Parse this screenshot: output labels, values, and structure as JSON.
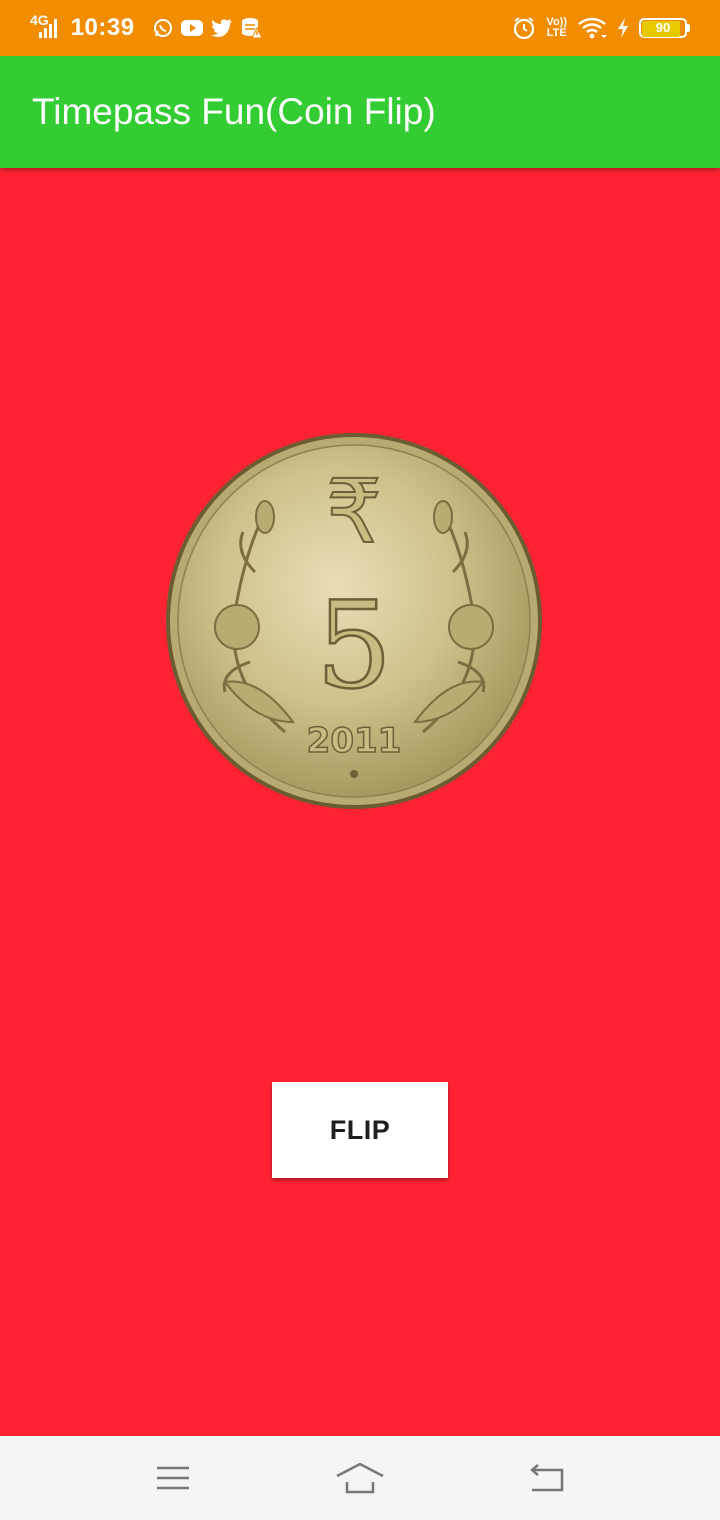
{
  "status_bar": {
    "network_type": "4G",
    "time": "10:39",
    "notifications": [
      "whatsapp-icon",
      "youtube-icon",
      "twitter-icon",
      "storage-alert-icon"
    ],
    "volte_top": "Vo))",
    "volte_bottom": "LTE",
    "battery_level": "90",
    "battery_fraction": 0.9
  },
  "app_bar": {
    "title": "Timepass Fun(Coin Flip)"
  },
  "coin": {
    "value": "5",
    "year": "2011",
    "currency_symbol": "₹"
  },
  "flip_button": {
    "label": "FLIP"
  },
  "nav_bar": {
    "buttons": [
      "menu-icon",
      "home-icon",
      "back-icon"
    ]
  },
  "colors": {
    "status_bar": "#f28c00",
    "app_bar": "#33cc33",
    "background": "#ff2233",
    "button": "#ffffff",
    "nav_bar": "#f5f5f5"
  }
}
